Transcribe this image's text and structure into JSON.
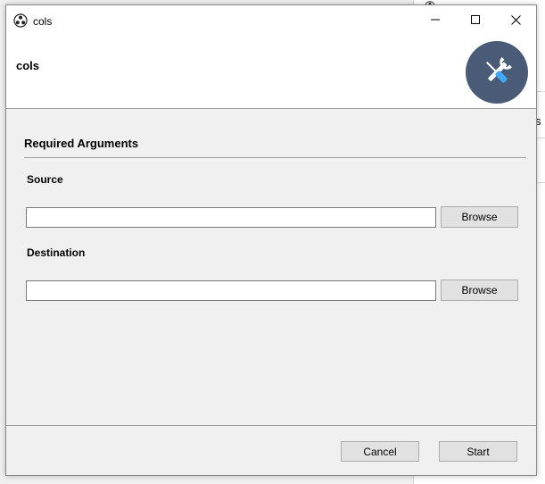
{
  "window": {
    "title": "cols"
  },
  "header": {
    "title": "cols",
    "logo_icon": "wrench-screwdriver-icon"
  },
  "background_window": {
    "partial_text": "s"
  },
  "form": {
    "section_title": "Required Arguments",
    "fields": [
      {
        "label": "Source",
        "value": "",
        "browse_label": "Browse"
      },
      {
        "label": "Destination",
        "value": "",
        "browse_label": "Browse"
      }
    ]
  },
  "footer": {
    "cancel_label": "Cancel",
    "start_label": "Start"
  },
  "colors": {
    "logo_bg": "#4a5b78",
    "logo_accent": "#3fa9f5",
    "window_bg": "#f0f0f0",
    "header_bg": "#ffffff"
  }
}
